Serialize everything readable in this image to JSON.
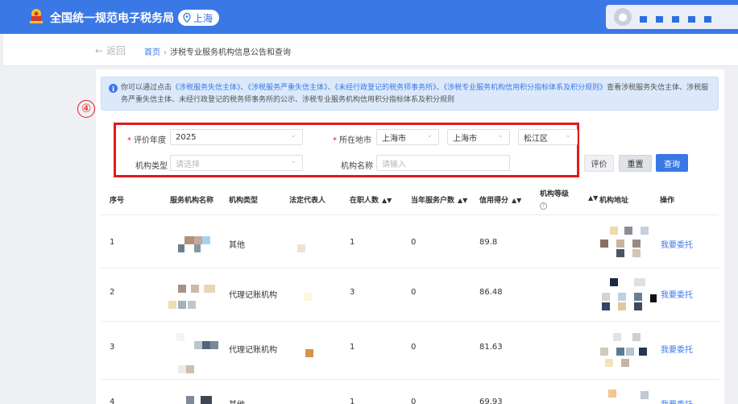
{
  "header": {
    "title": "全国统一规范电子税务局",
    "location": "上海",
    "colors": {
      "primary": "#3a78e6",
      "annotation": "#e01b1b"
    }
  },
  "nav": {
    "back_label": "返回",
    "breadcrumb": {
      "home": "首页",
      "separator": "›",
      "current": "涉税专业服务机构信息公告和查询"
    }
  },
  "notice": {
    "prefix": "你可以通过点击",
    "links": [
      "《涉税服务失信主体》",
      "《涉税服务严重失信主体》",
      "《未经行政登记的税务师事务所》",
      "《涉税专业服务机构信用积分指标体系及积分规则》"
    ],
    "separator": "、",
    "suffix": "查看涉税服务失信主体、涉税服务严重失信主体、未经行政登记的税务师事务所的公示、涉税专业服务机构信用积分指标体系及积分规则"
  },
  "annotation": {
    "marker": "④"
  },
  "filters": {
    "year": {
      "label": "评价年度",
      "value": "2025"
    },
    "region": {
      "label": "所在地市",
      "province": "上海市",
      "city": "上海市",
      "district": "松江区"
    },
    "org_type": {
      "label": "机构类型",
      "placeholder": "请选择"
    },
    "org_name": {
      "label": "机构名称",
      "placeholder": "请输入"
    }
  },
  "buttons": {
    "evaluate": "评价",
    "reset": "重置",
    "query": "查询"
  },
  "table": {
    "columns": [
      "序号",
      "服务机构名称",
      "机构类型",
      "法定代表人",
      "在职人数",
      "当年服务户数",
      "信用得分",
      "机构等级",
      "机构地址",
      "操作"
    ],
    "rows": [
      {
        "index": "1",
        "type": "其他",
        "staff": "1",
        "served": "0",
        "score": "89.8",
        "action": "我要委托"
      },
      {
        "index": "2",
        "type": "代理记账机构",
        "staff": "3",
        "served": "0",
        "score": "86.48",
        "action": "我要委托"
      },
      {
        "index": "3",
        "type": "代理记账机构",
        "staff": "1",
        "served": "0",
        "score": "81.63",
        "action": "我要委托"
      },
      {
        "index": "4",
        "type": "其他",
        "staff": "1",
        "served": "0",
        "score": "69.93",
        "action": "我要委托"
      }
    ]
  },
  "icons": [
    "emblem-icon",
    "location-pin-icon",
    "user-avatar-icon",
    "back-arrow-icon",
    "info-icon",
    "chevron-down-icon",
    "sort-icon",
    "question-icon"
  ]
}
